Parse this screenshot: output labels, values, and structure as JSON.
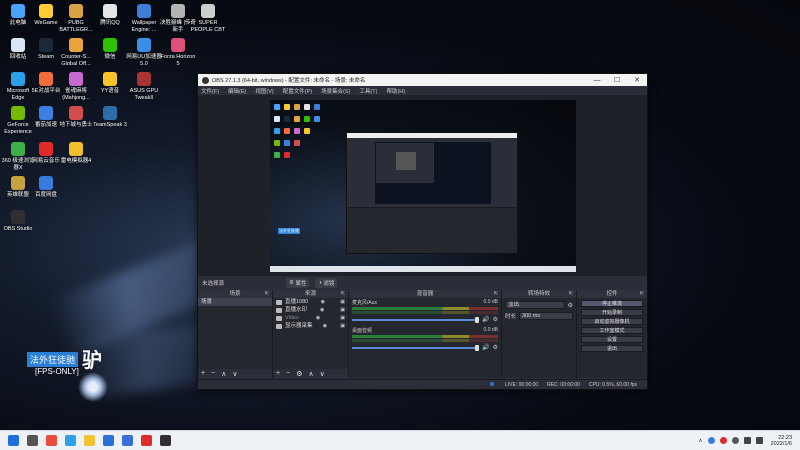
{
  "desktop": {
    "icons": [
      {
        "label": "此电脑",
        "color": "#4aa3ff"
      },
      {
        "label": "WeGame",
        "color": "#ffcc33"
      },
      {
        "label": "PUBG BATTLEGR...",
        "color": "#d9a441"
      },
      {
        "label": "腾讯QQ",
        "color": "#e5e5e5"
      },
      {
        "label": "Wallpaper Engine: ...",
        "color": "#3d7dd8"
      },
      {
        "label": "决胜巅峰 |传奇新手",
        "color": "#b3b3b3"
      },
      {
        "label": "SUPER PEOPLE CBT",
        "color": "#cfcfcf"
      },
      {
        "label": "回收站",
        "color": "#d8e6f5"
      },
      {
        "label": "Steam",
        "color": "#1b2838"
      },
      {
        "label": "Counter-S... Global Off...",
        "color": "#e8a33a"
      },
      {
        "label": "微信",
        "color": "#2dc100"
      },
      {
        "label": "网易UU加速器5.0",
        "color": "#3a8ee6"
      },
      {
        "label": "Forza Horizon 5",
        "color": "#e04f7a"
      },
      {
        "label": "Microsoft Edge",
        "color": "#2ea0e8"
      },
      {
        "label": "5E对战平台",
        "color": "#f26b3a"
      },
      {
        "label": "雀魂麻将 (Mahjong...",
        "color": "#c96ad1"
      },
      {
        "label": "YY语音",
        "color": "#f7c52a"
      },
      {
        "label": "ASUS GPU TweakII",
        "color": "#a33"
      },
      {
        "label": "GeForce Experience",
        "color": "#76b900"
      },
      {
        "label": "番茄加速",
        "color": "#3b7fe0"
      },
      {
        "label": "地下城与勇士",
        "color": "#d24d4d"
      },
      {
        "label": "TeamSpeak 3",
        "color": "#2d6ea8"
      },
      {
        "label": "360 极速浏览器X",
        "color": "#3cb14a"
      },
      {
        "label": "网易云音乐",
        "color": "#e02b2b"
      },
      {
        "label": "雷电模拟器4",
        "color": "#f2c02a"
      },
      {
        "label": "英雄联盟",
        "color": "#c7a340"
      },
      {
        "label": "百度网盘",
        "color": "#3a7be0"
      },
      {
        "label": "OBS Studio",
        "color": "#302e31"
      }
    ],
    "overlay": {
      "title": "法外狂徒驰",
      "big": "驴",
      "fps": "[FPS-ONLY]"
    }
  },
  "obs": {
    "title": "OBS 27.1.3 (64-bit, windows) - 配置文件: 未命名 - 场景: 未命名",
    "window_buttons": [
      "—",
      "☐",
      "✕"
    ],
    "menu": [
      "文件(F)",
      "编辑(E)",
      "视图(V)",
      "配置文件(P)",
      "场景集合(S)",
      "工具(T)",
      "帮助(H)"
    ],
    "no_source_label": "未选择源",
    "toolbar": {
      "properties": "属性",
      "filters": "滤镜"
    },
    "docks": {
      "scenes": {
        "title": "场景",
        "items": [
          "场景"
        ]
      },
      "sources": {
        "title": "来源",
        "items": [
          "直播1080",
          "直播水印",
          "Video",
          "显示器采集"
        ]
      },
      "mixer": {
        "title": "混音器",
        "channels": [
          {
            "name": "麦克风/Aux",
            "db": "0.0 dB"
          },
          {
            "name": "桌面音频",
            "db": "0.0 dB"
          }
        ]
      },
      "transitions": {
        "title": "转场特效",
        "selected": "淡出",
        "duration_label": "时长",
        "duration": "300 ms"
      },
      "controls": {
        "title": "控件",
        "buttons": [
          "停止推流",
          "开始录制",
          "启动虚拟摄像机",
          "工作室模式",
          "设置",
          "退出"
        ]
      }
    },
    "status": {
      "live": "LIVE: 00:00:00",
      "rec": "REC: 00:00:00",
      "cpu": "CPU: 0.5%, 60.00 fps"
    }
  },
  "taskbar": {
    "icons": [
      {
        "name": "windows-start",
        "color": "#1d6fe0"
      },
      {
        "name": "search",
        "color": "#555"
      },
      {
        "name": "chrome",
        "color": "#e74c3c"
      },
      {
        "name": "edge",
        "color": "#2ea0e8"
      },
      {
        "name": "explorer",
        "color": "#f2c230"
      },
      {
        "name": "mail",
        "color": "#2b6fd8"
      },
      {
        "name": "store",
        "color": "#3b6fd8"
      },
      {
        "name": "netease-music",
        "color": "#e02b2b"
      },
      {
        "name": "obs",
        "color": "#302e31"
      }
    ],
    "clock_time": "22:23",
    "clock_date": "2022/1/6"
  }
}
